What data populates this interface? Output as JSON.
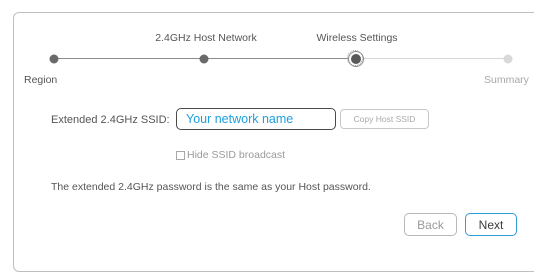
{
  "stepper": {
    "steps": [
      {
        "label": "Region",
        "state": "done"
      },
      {
        "label": "2.4GHz Host Network",
        "state": "done"
      },
      {
        "label": "Wireless Settings",
        "state": "current"
      },
      {
        "label": "Summary",
        "state": "pending"
      }
    ]
  },
  "form": {
    "ssid_label": "Extended 2.4GHz SSID:",
    "ssid_placeholder": "Your network name",
    "ssid_value": "",
    "copy_button_label": "Copy Host SSID",
    "hide_ssid_label": "Hide SSID broadcast",
    "hide_ssid_checked": false,
    "password_note": "The extended 2.4GHz password is the same as your Host password."
  },
  "footer": {
    "back_label": "Back",
    "next_label": "Next"
  },
  "colors": {
    "accent": "#2e9ed6",
    "input_text": "#1fa0dc",
    "done_dot": "#6a6a6a",
    "pending_dot": "#d9d9d9"
  }
}
